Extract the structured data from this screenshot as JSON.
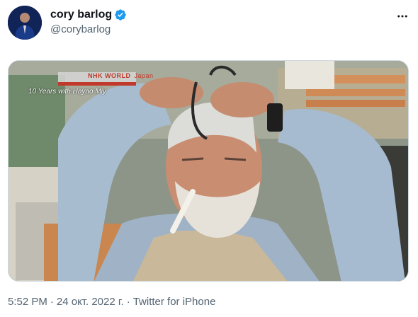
{
  "tweet": {
    "author": {
      "name": "cory barlog",
      "handle": "@corybarlog",
      "verified_icon": "verified-badge-icon"
    },
    "more_icon": "more-horizontal-icon",
    "media": {
      "overlay_logo": "NHK WORLD",
      "overlay_logo_sub": "Japan",
      "overlay_caption": "10 Years with Hayao Miy"
    },
    "meta": {
      "time": "5:52 PM",
      "date": "24 окт. 2022 г.",
      "separator": "·",
      "source": "Twitter for iPhone"
    }
  },
  "colors": {
    "text_primary": "#0f1419",
    "text_secondary": "#536471",
    "verified_blue": "#1d9bf0",
    "border": "#cfd9de"
  }
}
